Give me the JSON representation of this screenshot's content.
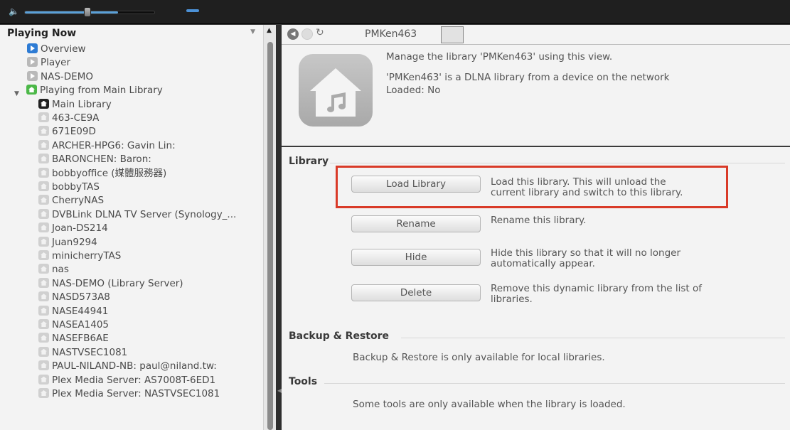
{
  "player": {
    "volume_icon": "speaker-icon",
    "volume_level": 0.72
  },
  "tree": {
    "title": "Playing Now",
    "items": [
      {
        "label": "Overview",
        "icon": "play-icon"
      },
      {
        "label": "Player",
        "icon": "play-icon"
      },
      {
        "label": "NAS-DEMO",
        "icon": "play-icon"
      },
      {
        "label": "Playing from Main Library",
        "icon": "home-icon"
      },
      {
        "label": "Main Library",
        "icon": "home-icon"
      },
      {
        "label": "463-CE9A",
        "icon": "library-icon"
      },
      {
        "label": "671E09D",
        "icon": "library-icon"
      },
      {
        "label": "ARCHER-HPG6: Gavin Lin:",
        "icon": "library-icon"
      },
      {
        "label": "BARONCHEN: Baron:",
        "icon": "library-icon"
      },
      {
        "label": "bobbyoffice (媒體服務器)",
        "icon": "library-icon"
      },
      {
        "label": "bobbyTAS",
        "icon": "library-icon"
      },
      {
        "label": "CherryNAS",
        "icon": "library-icon"
      },
      {
        "label": "DVBLink DLNA TV Server (Synology_...",
        "icon": "library-icon"
      },
      {
        "label": "Joan-DS214",
        "icon": "library-icon"
      },
      {
        "label": "Juan9294",
        "icon": "library-icon"
      },
      {
        "label": "minicherryTAS",
        "icon": "library-icon"
      },
      {
        "label": "nas",
        "icon": "library-icon"
      },
      {
        "label": "NAS-DEMO (Library Server)",
        "icon": "library-icon"
      },
      {
        "label": "NASD573A8",
        "icon": "library-icon"
      },
      {
        "label": "NASE44941",
        "icon": "library-icon"
      },
      {
        "label": "NASEA1405",
        "icon": "library-icon"
      },
      {
        "label": "NASEFB6AE",
        "icon": "library-icon"
      },
      {
        "label": "NASTVSEC1081",
        "icon": "library-icon"
      },
      {
        "label": "PAUL-NILAND-NB: paul@niland.tw:",
        "icon": "library-icon"
      },
      {
        "label": "Plex Media Server: AS7008T-6ED1",
        "icon": "library-icon"
      },
      {
        "label": "Plex Media Server: NASTVSEC1081",
        "icon": "library-icon"
      }
    ]
  },
  "tabs": {
    "active": "PMKen463"
  },
  "info": {
    "manage_text": "Manage the library 'PMKen463' using this view.",
    "dlna_text": "'PMKen463' is a DLNA library from a device on the network",
    "loaded_text": "Loaded: No"
  },
  "library_section": {
    "title": "Library",
    "actions": [
      {
        "label": "Load Library",
        "desc": [
          "Load this library.  This will unload the",
          "current library and switch to this library."
        ]
      },
      {
        "label": "Rename",
        "desc": [
          "Rename this library."
        ]
      },
      {
        "label": "Hide",
        "desc": [
          "Hide this library so that it will no longer",
          "automatically appear."
        ]
      },
      {
        "label": "Delete",
        "desc": [
          "Remove this dynamic library from the list of",
          "libraries."
        ]
      }
    ]
  },
  "backup_section": {
    "title": "Backup & Restore",
    "text": "Backup & Restore is only available for local libraries."
  },
  "tools_section": {
    "title": "Tools",
    "text": "Some tools are only available when the library is loaded."
  },
  "colors": {
    "highlight": "#d93a28",
    "accent": "#2d7bd4"
  }
}
